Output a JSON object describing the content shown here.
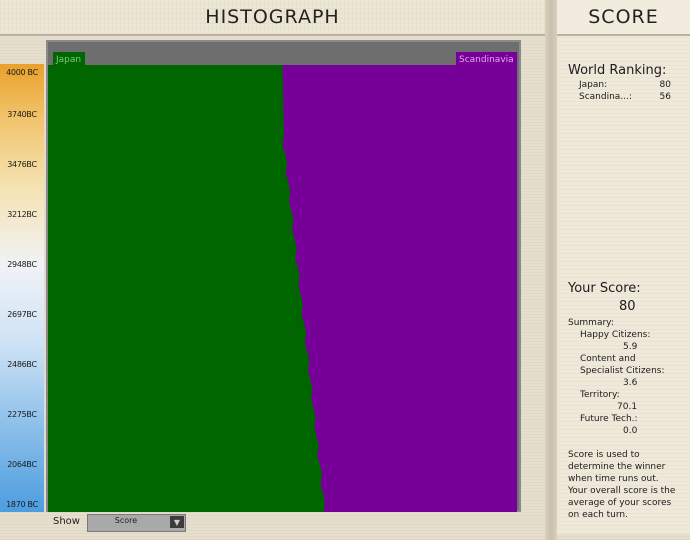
{
  "header": {
    "left_title": "HISTOGRAPH",
    "right_title": "SCORE"
  },
  "histograph": {
    "scale_ticks": [
      "4000 BC",
      "3740BC",
      "3476BC",
      "3212BC",
      "2948BC",
      "2697BC",
      "2486BC",
      "2275BC",
      "2064BC",
      "1870 BC"
    ],
    "civ_labels": {
      "japan": "Japan",
      "scandinavia": "Scandinavia"
    },
    "colors": {
      "japan": "#006600",
      "scandinavia": "#770099"
    },
    "japan_share_top": 0.5,
    "japan_share_bottom": 0.59
  },
  "show_bar": {
    "label": "Show",
    "selected": "Score"
  },
  "world_ranking": {
    "title": "World Ranking:",
    "rows": [
      {
        "name": "Japan:",
        "score": "80"
      },
      {
        "name": "Scandina...:",
        "score": "56"
      }
    ]
  },
  "your_score": {
    "title": "Your Score:",
    "value": "80",
    "summary_label": "Summary:",
    "happy_label": "Happy Citizens:",
    "happy_value": "5.9",
    "content_label1": "Content and",
    "content_label2": "Specialist Citizens:",
    "content_value": "3.6",
    "territory_label": "Territory:",
    "territory_value": "70.1",
    "future_label": "Future Tech.:",
    "future_value": "0.0",
    "note_lines": [
      "Score is used to",
      "determine the winner",
      "when time runs out.",
      "Your overall score is the",
      "average of your scores",
      "on each turn."
    ]
  }
}
